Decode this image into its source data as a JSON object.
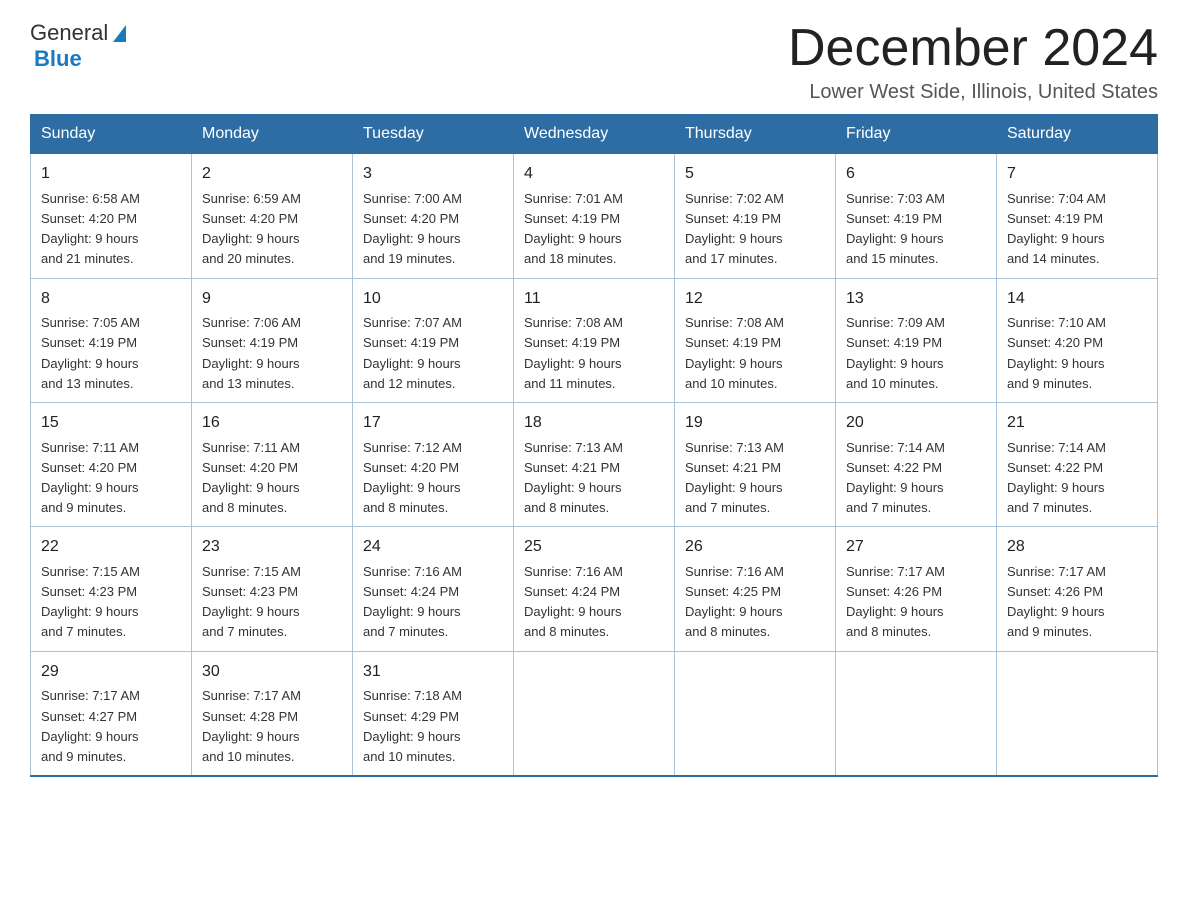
{
  "logo": {
    "general": "General",
    "blue": "Blue"
  },
  "title": "December 2024",
  "location": "Lower West Side, Illinois, United States",
  "days_of_week": [
    "Sunday",
    "Monday",
    "Tuesday",
    "Wednesday",
    "Thursday",
    "Friday",
    "Saturday"
  ],
  "weeks": [
    [
      {
        "day": "1",
        "sunrise": "6:58 AM",
        "sunset": "4:20 PM",
        "daylight": "9 hours and 21 minutes."
      },
      {
        "day": "2",
        "sunrise": "6:59 AM",
        "sunset": "4:20 PM",
        "daylight": "9 hours and 20 minutes."
      },
      {
        "day": "3",
        "sunrise": "7:00 AM",
        "sunset": "4:20 PM",
        "daylight": "9 hours and 19 minutes."
      },
      {
        "day": "4",
        "sunrise": "7:01 AM",
        "sunset": "4:19 PM",
        "daylight": "9 hours and 18 minutes."
      },
      {
        "day": "5",
        "sunrise": "7:02 AM",
        "sunset": "4:19 PM",
        "daylight": "9 hours and 17 minutes."
      },
      {
        "day": "6",
        "sunrise": "7:03 AM",
        "sunset": "4:19 PM",
        "daylight": "9 hours and 15 minutes."
      },
      {
        "day": "7",
        "sunrise": "7:04 AM",
        "sunset": "4:19 PM",
        "daylight": "9 hours and 14 minutes."
      }
    ],
    [
      {
        "day": "8",
        "sunrise": "7:05 AM",
        "sunset": "4:19 PM",
        "daylight": "9 hours and 13 minutes."
      },
      {
        "day": "9",
        "sunrise": "7:06 AM",
        "sunset": "4:19 PM",
        "daylight": "9 hours and 13 minutes."
      },
      {
        "day": "10",
        "sunrise": "7:07 AM",
        "sunset": "4:19 PM",
        "daylight": "9 hours and 12 minutes."
      },
      {
        "day": "11",
        "sunrise": "7:08 AM",
        "sunset": "4:19 PM",
        "daylight": "9 hours and 11 minutes."
      },
      {
        "day": "12",
        "sunrise": "7:08 AM",
        "sunset": "4:19 PM",
        "daylight": "9 hours and 10 minutes."
      },
      {
        "day": "13",
        "sunrise": "7:09 AM",
        "sunset": "4:19 PM",
        "daylight": "9 hours and 10 minutes."
      },
      {
        "day": "14",
        "sunrise": "7:10 AM",
        "sunset": "4:20 PM",
        "daylight": "9 hours and 9 minutes."
      }
    ],
    [
      {
        "day": "15",
        "sunrise": "7:11 AM",
        "sunset": "4:20 PM",
        "daylight": "9 hours and 9 minutes."
      },
      {
        "day": "16",
        "sunrise": "7:11 AM",
        "sunset": "4:20 PM",
        "daylight": "9 hours and 8 minutes."
      },
      {
        "day": "17",
        "sunrise": "7:12 AM",
        "sunset": "4:20 PM",
        "daylight": "9 hours and 8 minutes."
      },
      {
        "day": "18",
        "sunrise": "7:13 AM",
        "sunset": "4:21 PM",
        "daylight": "9 hours and 8 minutes."
      },
      {
        "day": "19",
        "sunrise": "7:13 AM",
        "sunset": "4:21 PM",
        "daylight": "9 hours and 7 minutes."
      },
      {
        "day": "20",
        "sunrise": "7:14 AM",
        "sunset": "4:22 PM",
        "daylight": "9 hours and 7 minutes."
      },
      {
        "day": "21",
        "sunrise": "7:14 AM",
        "sunset": "4:22 PM",
        "daylight": "9 hours and 7 minutes."
      }
    ],
    [
      {
        "day": "22",
        "sunrise": "7:15 AM",
        "sunset": "4:23 PM",
        "daylight": "9 hours and 7 minutes."
      },
      {
        "day": "23",
        "sunrise": "7:15 AM",
        "sunset": "4:23 PM",
        "daylight": "9 hours and 7 minutes."
      },
      {
        "day": "24",
        "sunrise": "7:16 AM",
        "sunset": "4:24 PM",
        "daylight": "9 hours and 7 minutes."
      },
      {
        "day": "25",
        "sunrise": "7:16 AM",
        "sunset": "4:24 PM",
        "daylight": "9 hours and 8 minutes."
      },
      {
        "day": "26",
        "sunrise": "7:16 AM",
        "sunset": "4:25 PM",
        "daylight": "9 hours and 8 minutes."
      },
      {
        "day": "27",
        "sunrise": "7:17 AM",
        "sunset": "4:26 PM",
        "daylight": "9 hours and 8 minutes."
      },
      {
        "day": "28",
        "sunrise": "7:17 AM",
        "sunset": "4:26 PM",
        "daylight": "9 hours and 9 minutes."
      }
    ],
    [
      {
        "day": "29",
        "sunrise": "7:17 AM",
        "sunset": "4:27 PM",
        "daylight": "9 hours and 9 minutes."
      },
      {
        "day": "30",
        "sunrise": "7:17 AM",
        "sunset": "4:28 PM",
        "daylight": "9 hours and 10 minutes."
      },
      {
        "day": "31",
        "sunrise": "7:18 AM",
        "sunset": "4:29 PM",
        "daylight": "9 hours and 10 minutes."
      },
      null,
      null,
      null,
      null
    ]
  ],
  "labels": {
    "sunrise": "Sunrise:",
    "sunset": "Sunset:",
    "daylight": "Daylight:"
  }
}
